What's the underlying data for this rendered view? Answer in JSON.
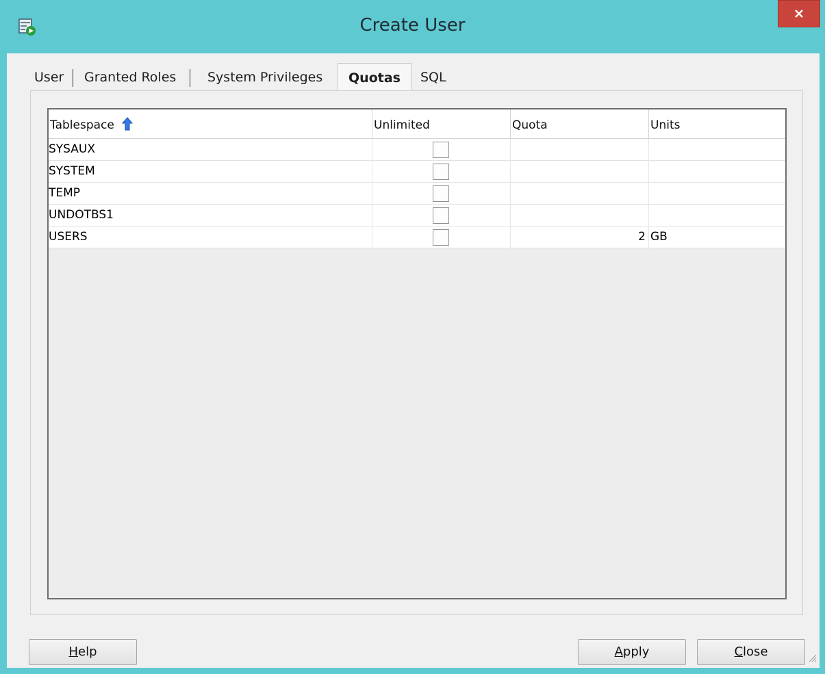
{
  "window": {
    "title": "Create User",
    "app_icon": "create-user-icon",
    "close_icon": "close-icon"
  },
  "tabs": [
    {
      "label": "User",
      "active": false
    },
    {
      "label": "Granted Roles",
      "active": false
    },
    {
      "label": "System Privileges",
      "active": false
    },
    {
      "label": "Quotas",
      "active": true
    },
    {
      "label": "SQL",
      "active": false
    }
  ],
  "table": {
    "columns": [
      "Tablespace",
      "Unlimited",
      "Quota",
      "Units"
    ],
    "sort_icon": "sort-ascending-icon",
    "rows": [
      {
        "tablespace": "SYSAUX",
        "unlimited": false,
        "quota": "",
        "units": ""
      },
      {
        "tablespace": "SYSTEM",
        "unlimited": false,
        "quota": "",
        "units": ""
      },
      {
        "tablespace": "TEMP",
        "unlimited": false,
        "quota": "",
        "units": ""
      },
      {
        "tablespace": "UNDOTBS1",
        "unlimited": false,
        "quota": "",
        "units": ""
      },
      {
        "tablespace": "USERS",
        "unlimited": false,
        "quota": "2",
        "units": "GB"
      }
    ]
  },
  "buttons": {
    "help": {
      "mnemonic": "H",
      "rest": "elp"
    },
    "apply": {
      "mnemonic": "A",
      "rest": "pply"
    },
    "close": {
      "mnemonic": "C",
      "rest": "lose"
    }
  },
  "colors": {
    "titlebar": "#5ec9d0",
    "close_button": "#c9443a",
    "sort_arrow": "#2f7be8"
  }
}
